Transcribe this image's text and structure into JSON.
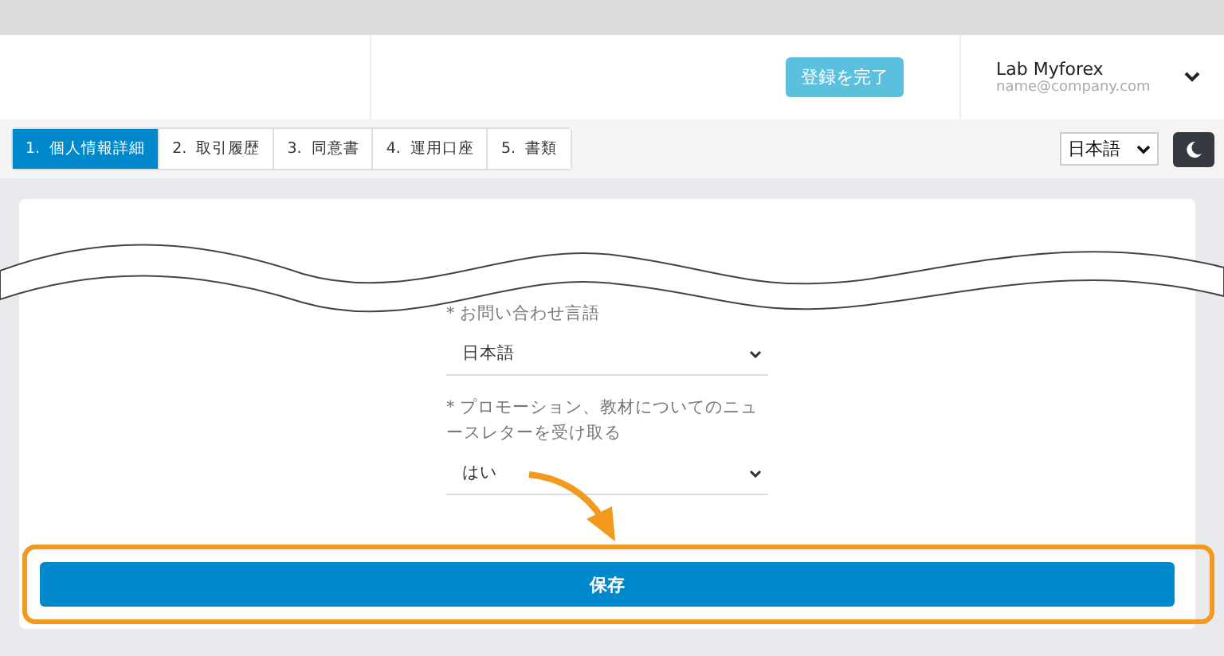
{
  "header": {
    "complete_button": "登録を完了",
    "user": {
      "name": "Lab Myforex",
      "email": "name@company.com"
    }
  },
  "tabs": [
    {
      "label": "1.  個人情報詳細",
      "selected": true
    },
    {
      "label": "2.  取引履歴",
      "selected": false
    },
    {
      "label": "3.  同意書",
      "selected": false
    },
    {
      "label": "4.  運用口座",
      "selected": false
    },
    {
      "label": "5.  書類",
      "selected": false
    }
  ],
  "language_select": {
    "value": "日本語"
  },
  "form": {
    "fields": [
      {
        "label": "* お問い合わせ言語",
        "value": "日本語"
      },
      {
        "label": "* プロモーション、教材についてのニュースレターを受け取る",
        "value": "はい"
      }
    ],
    "save_button": "保存"
  }
}
